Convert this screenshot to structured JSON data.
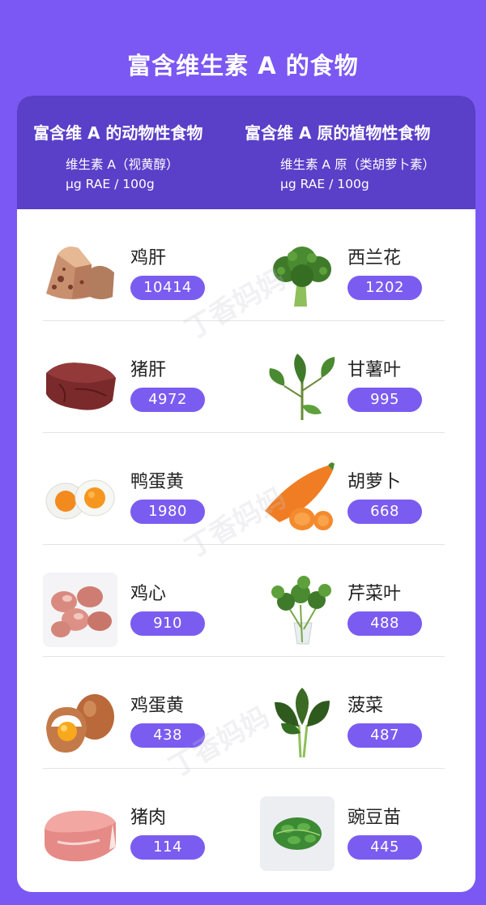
{
  "page": {
    "title": "富含维生素 A 的食物"
  },
  "columns": [
    {
      "title": "富含维 A 的动物性食物",
      "subtitle_line1": "维生素 A（视黄醇）",
      "subtitle_line2": "μg RAE / 100g"
    },
    {
      "title": "富含维 A 原的植物性食物",
      "subtitle_line1": "维生素 A 原（类胡萝卜素）",
      "subtitle_line2": "μg RAE / 100g"
    }
  ],
  "rows": [
    {
      "left": {
        "name": "鸡肝",
        "value": "10414",
        "icon": "chicken-liver"
      },
      "right": {
        "name": "西兰花",
        "value": "1202",
        "icon": "broccoli"
      }
    },
    {
      "left": {
        "name": "猪肝",
        "value": "4972",
        "icon": "pork-liver"
      },
      "right": {
        "name": "甘薯叶",
        "value": "995",
        "icon": "sweet-potato-leaves"
      }
    },
    {
      "left": {
        "name": "鸭蛋黄",
        "value": "1980",
        "icon": "salted-duck-egg"
      },
      "right": {
        "name": "胡萝卜",
        "value": "668",
        "icon": "carrot"
      }
    },
    {
      "left": {
        "name": "鸡心",
        "value": "910",
        "icon": "chicken-hearts"
      },
      "right": {
        "name": "芹菜叶",
        "value": "488",
        "icon": "celery-leaves"
      }
    },
    {
      "left": {
        "name": "鸡蛋黄",
        "value": "438",
        "icon": "egg-yolk"
      },
      "right": {
        "name": "菠菜",
        "value": "487",
        "icon": "spinach"
      }
    },
    {
      "left": {
        "name": "猪肉",
        "value": "114",
        "icon": "pork"
      },
      "right": {
        "name": "豌豆苗",
        "value": "445",
        "icon": "pea-shoots"
      }
    }
  ],
  "watermark": "丁香妈妈",
  "colors": {
    "background": "#7b57f3",
    "header": "#5a3fc8",
    "value_pill": "#7b5cf0",
    "card": "#ffffff"
  }
}
